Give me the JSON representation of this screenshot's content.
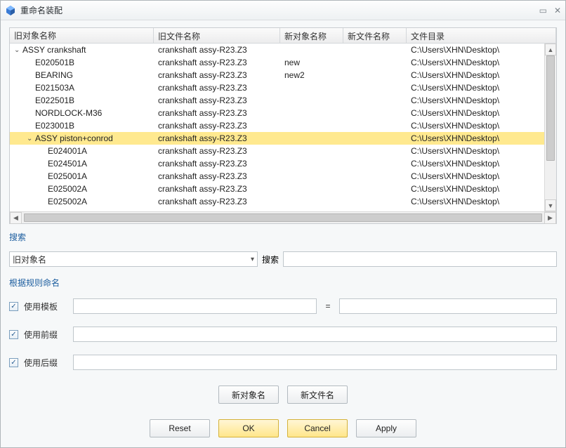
{
  "window": {
    "title": "重命名装配"
  },
  "columns": [
    "旧对象名称",
    "旧文件名称",
    "新对象名称",
    "新文件名称",
    "文件目录"
  ],
  "rows": [
    {
      "indent": 0,
      "expander": "v",
      "name": "ASSY crankshaft",
      "old": "crankshaft assy-R23.Z3",
      "nn": "",
      "nf": "",
      "dir": "C:\\Users\\XHN\\Desktop\\",
      "sel": false
    },
    {
      "indent": 1,
      "expander": "",
      "name": "E020501B",
      "old": "crankshaft assy-R23.Z3",
      "nn": "new",
      "nf": "",
      "dir": "C:\\Users\\XHN\\Desktop\\",
      "sel": false
    },
    {
      "indent": 1,
      "expander": "",
      "name": "BEARING",
      "old": "crankshaft assy-R23.Z3",
      "nn": "new2",
      "nf": "",
      "dir": "C:\\Users\\XHN\\Desktop\\",
      "sel": false
    },
    {
      "indent": 1,
      "expander": "",
      "name": "E021503A",
      "old": "crankshaft assy-R23.Z3",
      "nn": "",
      "nf": "",
      "dir": "C:\\Users\\XHN\\Desktop\\",
      "sel": false
    },
    {
      "indent": 1,
      "expander": "",
      "name": "E022501B",
      "old": "crankshaft assy-R23.Z3",
      "nn": "",
      "nf": "",
      "dir": "C:\\Users\\XHN\\Desktop\\",
      "sel": false
    },
    {
      "indent": 1,
      "expander": "",
      "name": "NORDLOCK-M36",
      "old": "crankshaft assy-R23.Z3",
      "nn": "",
      "nf": "",
      "dir": "C:\\Users\\XHN\\Desktop\\",
      "sel": false
    },
    {
      "indent": 1,
      "expander": "",
      "name": "E023001B",
      "old": "crankshaft assy-R23.Z3",
      "nn": "",
      "nf": "",
      "dir": "C:\\Users\\XHN\\Desktop\\",
      "sel": false
    },
    {
      "indent": 1,
      "expander": "v",
      "name": "ASSY piston+conrod",
      "old": "crankshaft assy-R23.Z3",
      "nn": "",
      "nf": "",
      "dir": "C:\\Users\\XHN\\Desktop\\",
      "sel": true
    },
    {
      "indent": 2,
      "expander": "",
      "name": "E024001A",
      "old": "crankshaft assy-R23.Z3",
      "nn": "",
      "nf": "",
      "dir": "C:\\Users\\XHN\\Desktop\\",
      "sel": false
    },
    {
      "indent": 2,
      "expander": "",
      "name": "E024501A",
      "old": "crankshaft assy-R23.Z3",
      "nn": "",
      "nf": "",
      "dir": "C:\\Users\\XHN\\Desktop\\",
      "sel": false
    },
    {
      "indent": 2,
      "expander": "",
      "name": "E025001A",
      "old": "crankshaft assy-R23.Z3",
      "nn": "",
      "nf": "",
      "dir": "C:\\Users\\XHN\\Desktop\\",
      "sel": false
    },
    {
      "indent": 2,
      "expander": "",
      "name": "E025002A",
      "old": "crankshaft assy-R23.Z3",
      "nn": "",
      "nf": "",
      "dir": "C:\\Users\\XHN\\Desktop\\",
      "sel": false
    },
    {
      "indent": 2,
      "expander": "",
      "name": "E025002A",
      "old": "crankshaft assy-R23.Z3",
      "nn": "",
      "nf": "",
      "dir": "C:\\Users\\XHN\\Desktop\\",
      "sel": false
    }
  ],
  "search": {
    "section": "搜索",
    "field_label": "旧对象名",
    "button": "搜索",
    "value": ""
  },
  "rules": {
    "section": "根据规则命名",
    "use_template": "使用模板",
    "use_prefix": "使用前缀",
    "use_suffix": "使用后缀",
    "eq": "=",
    "new_object": "新对象名",
    "new_file": "新文件名"
  },
  "footer": {
    "reset": "Reset",
    "ok": "OK",
    "cancel": "Cancel",
    "apply": "Apply"
  },
  "check": "✓"
}
